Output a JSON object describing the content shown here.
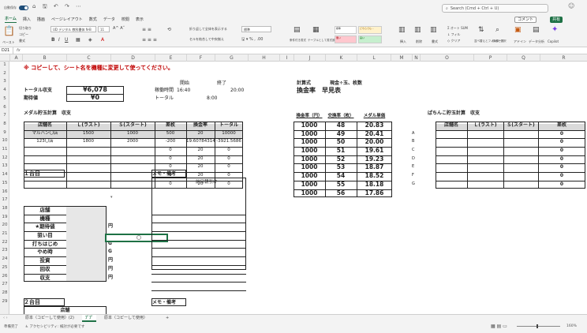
{
  "titlebar": {
    "autosave": "自動保存",
    "search": "Search (Cmd + Ctrl + U)"
  },
  "menu": [
    "ホーム",
    "挿入",
    "描画",
    "ページレイアウト",
    "数式",
    "データ",
    "校閲",
    "表示"
  ],
  "active_menu_index": 0,
  "comment_btn": "コメント",
  "share_btn": "共有",
  "ribbon": {
    "paste": "ペースト",
    "cut": "切り取り",
    "copy": "コピー",
    "format": "書式",
    "font": "UD デジタル 教科書体 N-B",
    "size": "11",
    "wrap": "折り返して全体を表示する",
    "merge": "セルを結合して中央揃え",
    "numfmt": "標準",
    "cond": "条件付き書式",
    "table": "テーブルとして書式設定",
    "styles": [
      "標準",
      "どちらでも...",
      "悪い",
      "良い"
    ],
    "insert": "挿入",
    "delete": "削除",
    "fmt2": "書式",
    "sum": "オート SUM",
    "fill": "フィル",
    "clear": "クリア",
    "sort": "並べ替えとフィルター",
    "find": "検索と選択",
    "addin": "アドイン",
    "analyze": "データ分析",
    "copilot": "Copilot"
  },
  "formula": {
    "cell": "D21",
    "fx": "fx"
  },
  "cols": [
    "A",
    "B",
    "C",
    "D",
    "E",
    "F",
    "G",
    "H",
    "I",
    "J",
    "K",
    "L",
    "M",
    "N",
    "O",
    "P",
    "Q",
    "R"
  ],
  "rows": [
    "1",
    "2",
    "3",
    "4",
    "5",
    "6",
    "7",
    "8",
    "9",
    "10",
    "11",
    "12",
    "13",
    "14",
    "15",
    "16",
    "17",
    "18",
    "19",
    "20",
    "21",
    "22",
    "23",
    "24",
    "25",
    "26",
    "27",
    "28",
    "29"
  ],
  "sheet": {
    "warning": "※ コピーして、シート名を機種に変更して使ってください。",
    "start_label": "開始",
    "end_label": "終了",
    "total_label": "トータル収支",
    "total_value": "¥6,078",
    "time_label": "稼働時間",
    "start_time": "16:40",
    "end_time": "20:00",
    "expect_label": "期待値",
    "expect_value": "¥0",
    "total2_label": "トータル",
    "total_hours": "8:00",
    "calc_label": "計算式",
    "calc_value": "現金÷玉、枚数",
    "rate_title": "換金率　早見表",
    "medal_title": "メダル貯玉計算　収支",
    "medal_headers": [
      "店舗名",
      "Ｌ(ラスト)",
      "Ｓ(スタート)",
      "差枚",
      "換金率",
      "トータル"
    ],
    "medal_rows": [
      [
        "マルハン〇店",
        "1500",
        "1000",
        "500",
        "20",
        "10000"
      ],
      [
        "123〇店",
        "1800",
        "2000",
        "-200",
        "19.60784314",
        "-3921.5686"
      ],
      [
        "",
        "",
        "",
        "0",
        "20",
        "0"
      ],
      [
        "",
        "",
        "",
        "0",
        "20",
        "0"
      ],
      [
        "",
        "",
        "",
        "0",
        "20",
        "0"
      ],
      [
        "",
        "",
        "",
        "0",
        "20",
        "0"
      ],
      [
        "",
        "",
        "",
        "0",
        "20",
        "0"
      ]
    ],
    "row_letters": [
      "A",
      "B",
      "C",
      "D",
      "E",
      "F",
      "G"
    ],
    "rate_headers": [
      "換金率（円）",
      "交換率（枚）",
      "メダル単価"
    ],
    "rate_rows": [
      [
        "1000",
        "48",
        "20.83"
      ],
      [
        "1000",
        "49",
        "20.41"
      ],
      [
        "1000",
        "50",
        "20.00"
      ],
      [
        "1000",
        "51",
        "19.61"
      ],
      [
        "1000",
        "52",
        "19.23"
      ],
      [
        "1000",
        "53",
        "18.87"
      ],
      [
        "1000",
        "54",
        "18.52"
      ],
      [
        "1000",
        "55",
        "18.18"
      ],
      [
        "1000",
        "56",
        "17.86"
      ]
    ],
    "pachinko_title": "ぱちんこ貯玉計算　収支",
    "pachinko_headers": [
      "店舗名",
      "Ｌ(ラスト)",
      "Ｓ(スタート)",
      "差枚"
    ],
    "pachinko_vals": [
      "0",
      "0",
      "0",
      "0",
      "0",
      "0",
      "0"
    ],
    "unit1": "１台目",
    "unit_labels": [
      "店舗",
      "機種",
      "★期待値",
      "狙い目",
      "打ちはじめ",
      "やめ時",
      "投資",
      "回収",
      "収支"
    ],
    "unit_suffix": [
      "",
      "",
      "円",
      "",
      "G",
      "G",
      "円",
      "円",
      "円"
    ],
    "memo_label": "メモ・備考",
    "memo_note": "前日朝引け",
    "unit2": "２台目",
    "unit2_first": "店舗"
  },
  "tabs": [
    "原本（コピーして使用）(2)",
    "ﾌﾞﾌﾞ",
    "原本（コピーして使用）",
    "+"
  ],
  "active_tab_index": 1,
  "status": {
    "ready": "準備完了",
    "access": "アクセシビリティ: 検討が必要です",
    "zoom": "160%"
  }
}
